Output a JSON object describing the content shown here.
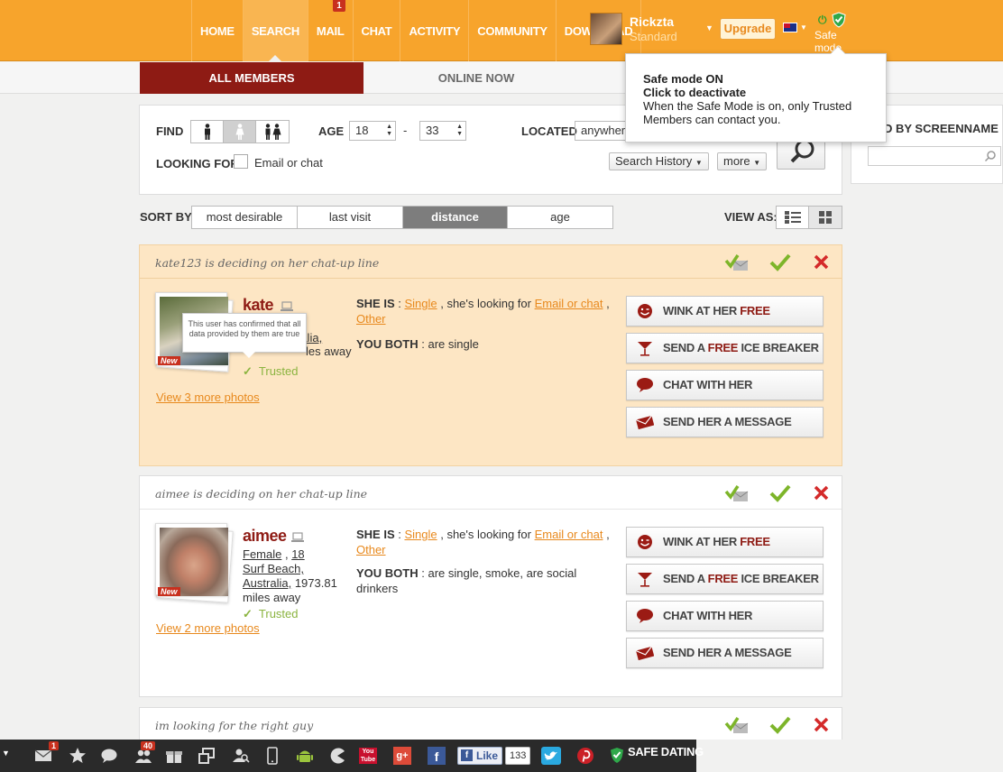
{
  "nav": {
    "items": [
      {
        "label": "HOME"
      },
      {
        "label": "SEARCH"
      },
      {
        "label": "MAIL",
        "badge": "1"
      },
      {
        "label": "CHAT"
      },
      {
        "label": "ACTIVITY"
      },
      {
        "label": "COMMUNITY"
      },
      {
        "label": "DOWNLOAD"
      }
    ]
  },
  "user": {
    "name": "Rickzta",
    "level": "Standard",
    "upgrade_label": "Upgrade"
  },
  "safe_mode": {
    "label": "Safe mode",
    "tooltip_title": "Safe mode ON",
    "tooltip_sub": "Click to deactivate",
    "tooltip_body": "When the Safe Mode is on, only Trusted Members can contact you."
  },
  "subtabs": {
    "all": "ALL MEMBERS",
    "online": "ONLINE NOW"
  },
  "search": {
    "find_label": "FIND",
    "age_label": "AGE",
    "age_min": "18",
    "age_max": "33",
    "age_sep": "-",
    "located_label": "LOCATED",
    "location_value": "anywhere",
    "looking_for_label": "LOOKING FOR",
    "looking_for_option": "Email or chat",
    "history_label": "Search History",
    "more_label": "more",
    "screenname_label": "D BY SCREENNAME"
  },
  "sort": {
    "label": "SORT BY:",
    "options": [
      "most desirable",
      "last visit",
      "distance",
      "age"
    ],
    "active": "distance"
  },
  "view": {
    "label": "VIEW AS:"
  },
  "trusted_tip": "This user has confirmed that all data provided by them are true",
  "profiles": [
    {
      "header": "kate123 is deciding on her chat-up line",
      "name": "kate",
      "info_line1": "...",
      "info_frag_a": "ralia,",
      "info_frag_b": "les away",
      "trusted": "Trusted",
      "more_photos": "View 3 more photos",
      "she_is_label": "SHE IS",
      "status": "Single",
      "looking": "Email or chat",
      "other": "Other",
      "both_label": "YOU BOTH",
      "both": "are single",
      "new_label": "New"
    },
    {
      "header": "aimee is deciding on her chat-up line",
      "name": "aimee",
      "gender": "Female",
      "age": "18",
      "city": "Surf Beach,",
      "country": "Australia,",
      "distance": "1973.81",
      "distance_unit": "miles away",
      "trusted": "Trusted",
      "more_photos": "View 2 more photos",
      "she_is_label": "SHE IS",
      "status": "Single",
      "looking": "Email or chat",
      "other": "Other",
      "both_label": "YOU BOTH",
      "both": "are single, smoke, are social drinkers",
      "new_label": "New"
    },
    {
      "header": "im looking for the right guy"
    }
  ],
  "actions": {
    "wink_pre": "WINK AT HER ",
    "wink_free": "FREE",
    "ice_pre": "SEND A ",
    "ice_free": "FREE",
    "ice_post": " ICE BREAKER",
    "chat": "CHAT WITH HER",
    "message": "SEND HER A MESSAGE"
  },
  "bottombar": {
    "mail_badge": "1",
    "friends_badge": "40",
    "like_label": "Like",
    "like_count": "133",
    "safe_dating": "SAFE DATING"
  },
  "colors": {
    "topbar": "#f7a42c",
    "brand_red": "#8e1b14",
    "link_orange": "#e8891d",
    "trusted_green": "#8bb440",
    "highlight_card": "#fde6c4"
  }
}
